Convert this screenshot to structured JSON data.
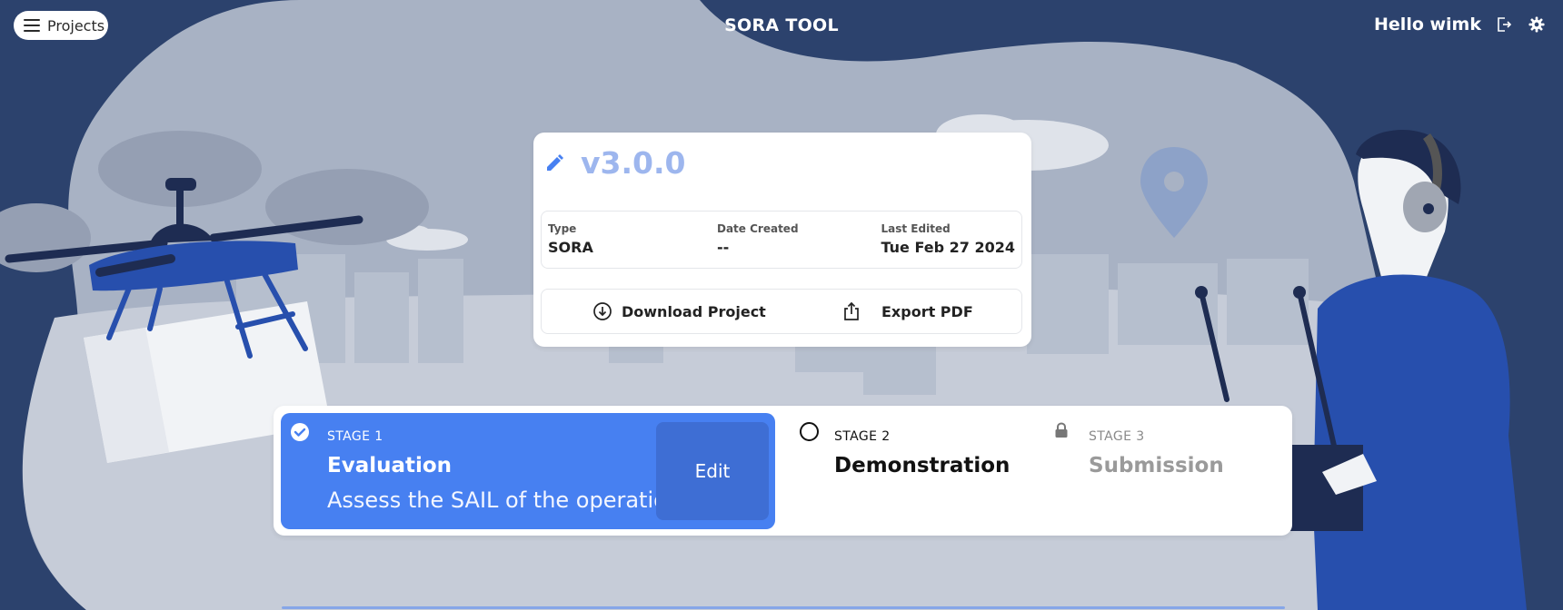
{
  "header": {
    "projects_label": "Projects",
    "title": "SORA TOOL",
    "greeting": "Hello wimk",
    "icons": [
      "menu-icon",
      "logout-icon",
      "gear-icon"
    ]
  },
  "project": {
    "version": "v3.0.0",
    "type_label": "Type",
    "type_value": "SORA",
    "date_created_label": "Date Created",
    "date_created_value": "--",
    "last_edited_label": "Last Edited",
    "last_edited_value": "Tue Feb 27 2024",
    "download_label": "Download Project",
    "export_label": "Export PDF"
  },
  "stages": [
    {
      "number": "STAGE 1",
      "name": "Evaluation",
      "description": "Assess the SAIL of the operation",
      "status": "completed",
      "action": "Edit"
    },
    {
      "number": "STAGE 2",
      "name": "Demonstration",
      "status": "pending"
    },
    {
      "number": "STAGE 3",
      "name": "Submission",
      "status": "locked"
    }
  ],
  "colors": {
    "background_dark": "#2c426d",
    "accent": "#4780f1",
    "accent_dark": "#3e6ed4",
    "version_text": "#9db6ee",
    "illustration_blue": "#274fad"
  }
}
